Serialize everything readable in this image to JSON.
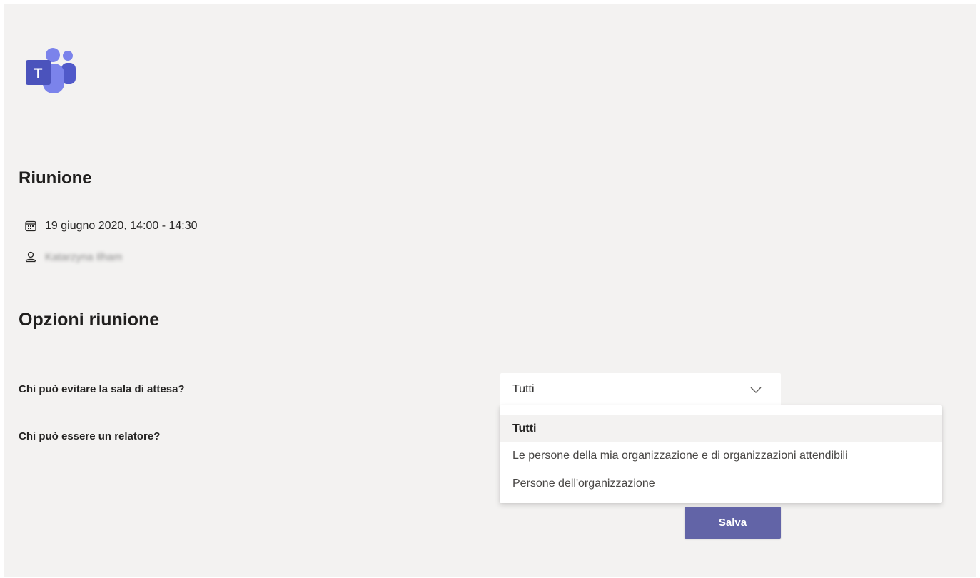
{
  "app": {
    "logo_icon": "microsoft-teams-logo",
    "logo_letter": "T",
    "brand_color": "#6264a7"
  },
  "meeting": {
    "heading": "Riunione",
    "date_icon": "calendar-icon",
    "date_time": "19 giugno 2020, 14:00 - 14:30",
    "organizer_icon": "person-icon",
    "organizer_name": "Katarzyna Ilham"
  },
  "options": {
    "heading": "Opzioni riunione",
    "lobby_question": "Chi può evitare la sala di attesa?",
    "lobby_selected": "Tutti",
    "chevron_icon": "chevron-down-icon",
    "lobby_options": [
      "Tutti",
      "Le persone della mia organizzazione e di organizzazioni attendibili",
      "Persone dell'organizzazione"
    ],
    "presenter_question": "Chi può essere un relatore?"
  },
  "actions": {
    "save_label": "Salva"
  }
}
